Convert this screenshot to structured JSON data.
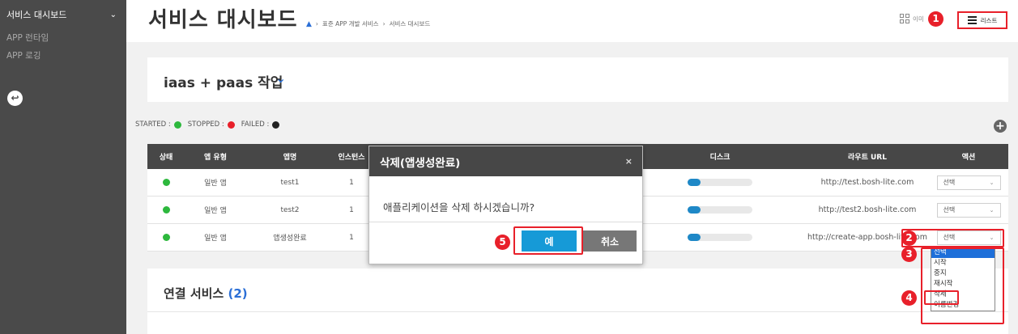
{
  "sidebar": {
    "header": "서비스 대시보드",
    "items": [
      "APP 런타임",
      "APP 로깅"
    ]
  },
  "header": {
    "title": "서비스 대시보드",
    "breadcrumb": [
      "표준 APP 개발 서비스",
      "서비스 대시보드"
    ],
    "view_image_label": "이미",
    "view_list_label": "리스트"
  },
  "org": {
    "title": "iaas + paas 작업"
  },
  "legend": {
    "started": "STARTED :",
    "stopped": "STOPPED :",
    "failed": "FAILED :"
  },
  "colors": {
    "started": "#2db83d",
    "stopped": "#e8202a",
    "failed": "#222222",
    "accent": "#2b6fd6",
    "annotation": "#e8202a"
  },
  "table": {
    "headers": {
      "status": "상태",
      "type": "앱 유형",
      "name": "앱명",
      "instances": "인스턴스",
      "disk": "디스크",
      "url": "라우트 URL",
      "action": "액션"
    },
    "rows": [
      {
        "type": "일반 앱",
        "name": "test1",
        "instances": "1",
        "disk_fraction": 0.2,
        "url": "http://test.bosh-lite.com",
        "action": "선택"
      },
      {
        "type": "일반 앱",
        "name": "test2",
        "instances": "1",
        "disk_fraction": 0.2,
        "url": "http://test2.bosh-lite.com",
        "action": "선택"
      },
      {
        "type": "일반 앱",
        "name": "앱생성완료",
        "instances": "1",
        "disk_fraction": 0.2,
        "url": "http://create-app.bosh-lite.com",
        "action": "선택"
      }
    ]
  },
  "dropdown": {
    "options": [
      "선택",
      "시작",
      "중지",
      "재시작",
      "삭제",
      "이름변경"
    ]
  },
  "services": {
    "title": "연결 서비스",
    "count": "(2)"
  },
  "modal": {
    "title": "삭제(앱생성완료)",
    "close": "×",
    "message": "애플리케이션을 삭제 하시겠습니까?",
    "yes": "예",
    "cancel": "취소"
  },
  "annotations": [
    "1",
    "2",
    "3",
    "4",
    "5"
  ]
}
